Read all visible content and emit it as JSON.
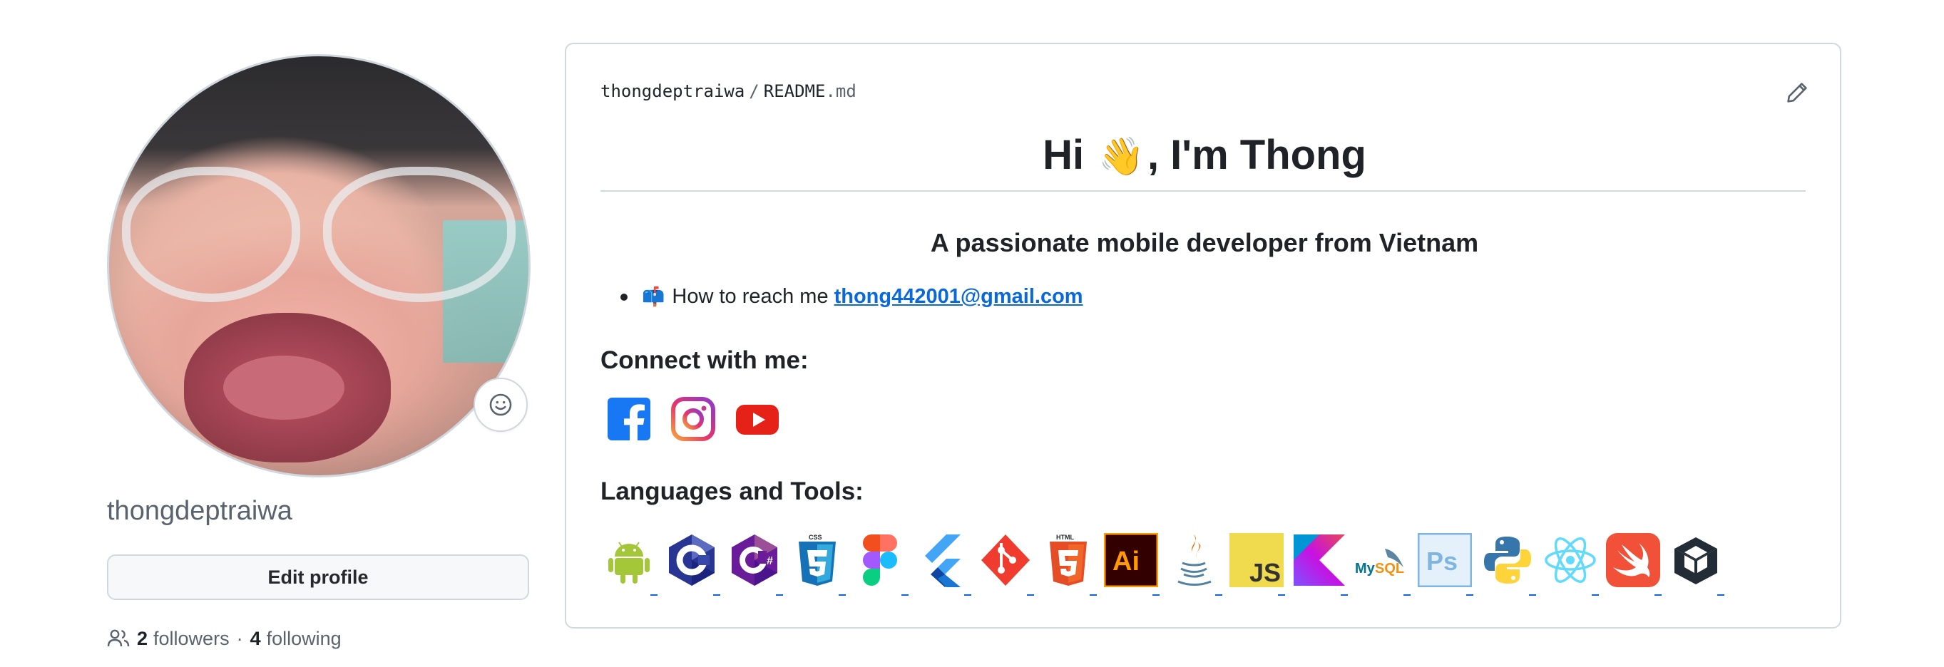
{
  "profile": {
    "username": "thongdeptraiwa",
    "edit_label": "Edit profile",
    "followers_count": "2",
    "followers_label": "followers",
    "separator": "·",
    "following_count": "4",
    "following_label": "following"
  },
  "readme": {
    "owner": "thongdeptraiwa",
    "path_sep": "/",
    "file_base": "README",
    "file_ext": ".md",
    "heading_pre": "Hi ",
    "heading_emoji": "👋",
    "heading_post": ", I'm Thong",
    "subheading": "A passionate mobile developer from Vietnam",
    "bullet_emoji": "📫",
    "bullet_text": "How to reach me",
    "email": "thong442001@gmail.com",
    "connect_title": "Connect with me:",
    "tools_title": "Languages and Tools:"
  },
  "social_links": [
    "facebook-icon",
    "instagram-icon",
    "youtube-icon"
  ],
  "tools": [
    "android-icon",
    "c-icon",
    "csharp-icon",
    "css3-icon",
    "figma-icon",
    "flutter-icon",
    "git-icon",
    "html5-icon",
    "illustrator-icon",
    "java-icon",
    "javascript-icon",
    "kotlin-icon",
    "mysql-icon",
    "photoshop-icon",
    "python-icon",
    "react-icon",
    "swift-icon",
    "unity-icon"
  ],
  "colors": {
    "link": "#0969da",
    "text": "#1f2328",
    "muted": "#59636e",
    "border": "#d1d9e0"
  }
}
